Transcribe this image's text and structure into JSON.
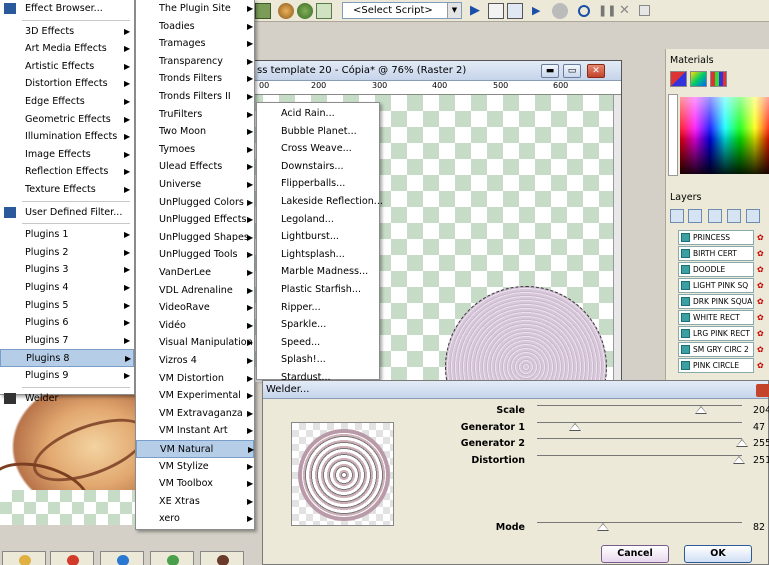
{
  "toolbar": {
    "script_select_value": "<Select Script>",
    "icons": [
      "layer-palette-icon",
      "script-run-icon",
      "script-stop-icon",
      "record-icon",
      "pause-icon",
      "close-icon",
      "save-icon"
    ]
  },
  "menu_effects": {
    "items": [
      {
        "label": "Effect Browser...",
        "submenu": false,
        "icon": "effect-browser-icon"
      },
      {
        "label": "3D Effects",
        "submenu": true
      },
      {
        "label": "Art Media Effects",
        "submenu": true
      },
      {
        "label": "Artistic Effects",
        "submenu": true
      },
      {
        "label": "Distortion Effects",
        "submenu": true
      },
      {
        "label": "Edge Effects",
        "submenu": true
      },
      {
        "label": "Geometric Effects",
        "submenu": true
      },
      {
        "label": "Illumination Effects",
        "submenu": true
      },
      {
        "label": "Image Effects",
        "submenu": true
      },
      {
        "label": "Reflection Effects",
        "submenu": true
      },
      {
        "label": "Texture Effects",
        "submenu": true
      },
      {
        "label": "User Defined Filter...",
        "submenu": false,
        "icon": "grid-icon"
      },
      {
        "label": "Plugins 1",
        "submenu": true
      },
      {
        "label": "Plugins 2",
        "submenu": true
      },
      {
        "label": "Plugins 3",
        "submenu": true
      },
      {
        "label": "Plugins 4",
        "submenu": true
      },
      {
        "label": "Plugins 5",
        "submenu": true
      },
      {
        "label": "Plugins 6",
        "submenu": true
      },
      {
        "label": "Plugins 7",
        "submenu": true
      },
      {
        "label": "Plugins 8",
        "submenu": true,
        "active": true
      },
      {
        "label": "Plugins 9",
        "submenu": true
      },
      {
        "label": "Welder",
        "submenu": false,
        "icon": "welder-icon"
      }
    ]
  },
  "menu_plugins": {
    "items": [
      "The Plugin Site",
      "Toadies",
      "Tramages",
      "Transparency",
      "Tronds Filters",
      "Tronds Filters II",
      "TruFilters",
      "Two Moon",
      "Tymoes",
      "Ulead Effects",
      "Universe",
      "UnPlugged Colors",
      "UnPlugged Effects",
      "UnPlugged Shapes",
      "UnPlugged Tools",
      "VanDerLee",
      "VDL Adrenaline",
      "VideoRave",
      "Vidéo",
      "Visual Manipulation",
      "Vizros 4",
      "VM Distortion",
      "VM Experimental",
      "VM Extravaganza",
      "VM Instant Art",
      "VM Natural",
      "VM Stylize",
      "VM Toolbox",
      "XE Xtras",
      "xero"
    ],
    "active_index": 25
  },
  "menu_vm_natural": {
    "items": [
      "Acid Rain...",
      "Bubble Planet...",
      "Cross Weave...",
      "Downstairs...",
      "Flipperballs...",
      "Lakeside Reflection...",
      "Legoland...",
      "Lightburst...",
      "Lightsplash...",
      "Marble Madness...",
      "Plastic Starfish...",
      "Ripper...",
      "Sparkle...",
      "Speed...",
      "Splash!...",
      "Stardust..."
    ]
  },
  "image_window": {
    "title": "ss template 20 - Cópia* @  76% (Raster 2)",
    "ruler_labels": [
      "00",
      "200",
      "300",
      "400",
      "500",
      "600"
    ]
  },
  "materials": {
    "title": "Materials"
  },
  "layers": {
    "title": "Layers",
    "rows": [
      "PRINCESS",
      "BIRTH CERT",
      "DOODLE",
      "LIGHT PINK SQ",
      "DRK PINK SQUA",
      "WHITE RECT",
      "LRG PINK RECT",
      "SM GRY CIRC 2",
      "PINK CIRCLE"
    ]
  },
  "welder": {
    "title": "Welder...",
    "params": [
      {
        "label": "Scale",
        "value": "204",
        "fraction": 0.8
      },
      {
        "label": "Generator 1",
        "value": "47",
        "fraction": 0.184
      },
      {
        "label": "Generator 2",
        "value": "255",
        "fraction": 1.0
      },
      {
        "label": "Distortion",
        "value": "251",
        "fraction": 0.984
      },
      {
        "label": "Mode",
        "value": "82",
        "fraction": 0.322
      }
    ],
    "cancel_label": "Cancel",
    "ok_label": "OK"
  }
}
